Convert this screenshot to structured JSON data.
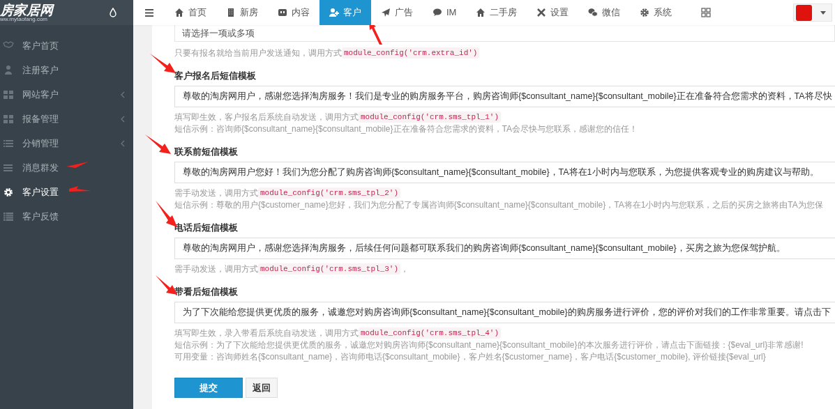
{
  "logo": {
    "text": "房家居网",
    "url": "ww.mytaofang.com"
  },
  "sidebar": {
    "items": [
      {
        "label": "客户首页",
        "selected": false,
        "has_submenu": false
      },
      {
        "label": "注册客户",
        "selected": false,
        "has_submenu": false
      },
      {
        "label": "网站客户",
        "selected": false,
        "has_submenu": true
      },
      {
        "label": "报备管理",
        "selected": false,
        "has_submenu": true
      },
      {
        "label": "分销管理",
        "selected": false,
        "has_submenu": true
      },
      {
        "label": "消息群发",
        "selected": false,
        "has_submenu": false
      },
      {
        "label": "客户设置",
        "selected": true,
        "has_submenu": false
      },
      {
        "label": "客户反馈",
        "selected": false,
        "has_submenu": false
      }
    ]
  },
  "top_nav": {
    "items": [
      {
        "label": "首页",
        "selected": false
      },
      {
        "label": "新房",
        "selected": false
      },
      {
        "label": "内容",
        "selected": false
      },
      {
        "label": "客户",
        "selected": true
      },
      {
        "label": "广告",
        "selected": false
      },
      {
        "label": "IM",
        "selected": false
      },
      {
        "label": "二手房",
        "selected": false
      },
      {
        "label": "设置",
        "selected": false
      },
      {
        "label": "微信",
        "selected": false
      },
      {
        "label": "系统",
        "selected": false
      }
    ]
  },
  "form": {
    "top_field": {
      "placeholder": "请选择一项或多项",
      "help": "只要有报名就给当前用户发送通知，调用方式",
      "code": "module_config('crm.extra_id')"
    },
    "sections": [
      {
        "label": "客户报名后短信模板",
        "value": "尊敬的淘房网用户，感谢您选择淘房服务！我们是专业的购房服务平台，购房咨询师{$consultant_name}{$consultant_mobile}正在准备符合您需求的资料，TA将尽快",
        "help": "填写即生效，客户报名后系统自动发送，调用方式",
        "code": "module_config('crm.sms_tpl_1')",
        "notes": [
          "短信示例：咨询师{$consultant_name}{$consultant_mobile}正在准备符合您需求的资料，TA会尽快与您联系，感谢您的信任！"
        ]
      },
      {
        "label": "联系前短信模板",
        "value": "尊敬的淘房网用户您好！我们为您分配了购房咨询师{$consultant_name}{$consultant_mobile}，TA将在1小时内与您联系，为您提供客观专业的购房建议与帮助。",
        "help": "需手动发送，调用方式",
        "code": "module_config('crm.sms_tpl_2')",
        "notes": [
          "短信示例：尊敬的用户{$customer_name}您好，我们为您分配了专属咨询师{$consultant_name}{$consultant_mobile}，TA将在1小时内与您联系，之后的买房之旅将由TA为您保"
        ]
      },
      {
        "label": "电话后短信模板",
        "value": "尊敬的淘房网用户，感谢您选择淘房服务，后续任何问题都可联系我们的购房咨询师{$consultant_name}{$consultant_mobile}，买房之旅为您保驾护航。",
        "help": "需手动发送，调用方式",
        "code": "module_config('crm.sms_tpl_3')",
        "help_after": "，"
      },
      {
        "label": "带看后短信模板",
        "value": "为了下次能给您提供更优质的服务，诚邀您对购房咨询师{$consultant_name}{$consultant_mobile}的购房服务进行评价，您的评价对我们的工作非常重要。请点击下",
        "help": "填写即生效，录入带看后系统自动发送，调用方式",
        "code": "module_config('crm.sms_tpl_4')",
        "notes": [
          "短信示例：为了下次能给您提供更优质的服务，诚邀您对购房咨询师{$consultant_name}{$consultant_mobile}的本次服务进行评价，请点击下面链接：{$eval_url}非常感谢!",
          "可用变量：咨询师姓名{$consultant_name}，咨询师电话{$consultant_mobile}，客户姓名{$customer_name}，客户电话{$customer_mobile}, 评价链接{$eval_url}"
        ]
      }
    ],
    "buttons": [
      {
        "label": "提交",
        "kind": "primary"
      },
      {
        "label": "返回",
        "kind": "default"
      }
    ]
  }
}
